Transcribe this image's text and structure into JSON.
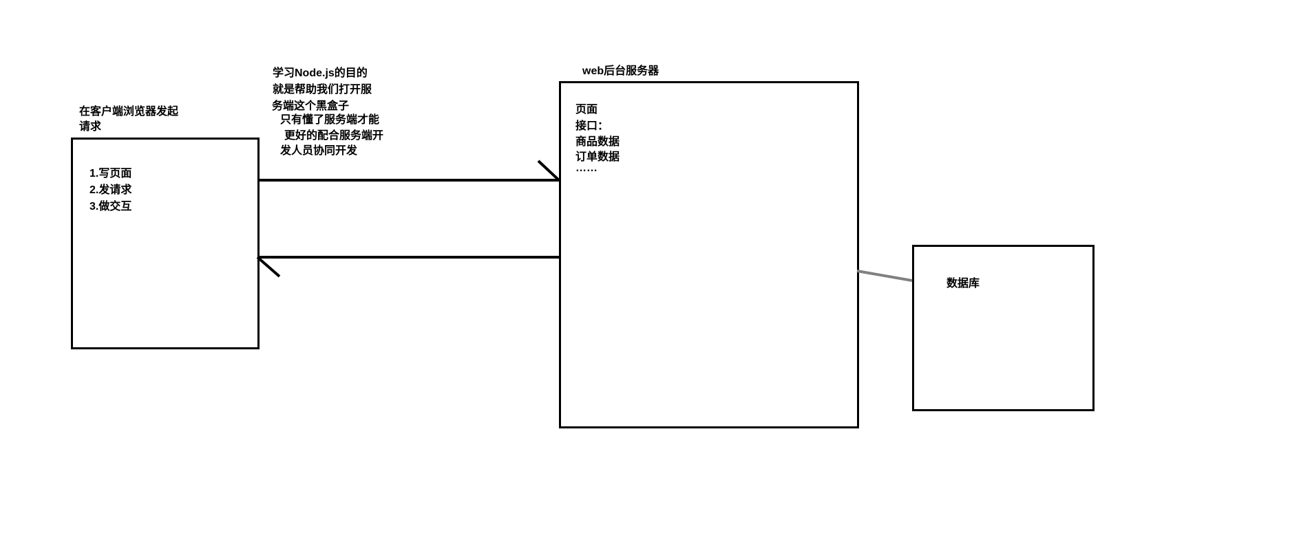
{
  "client": {
    "title_l1": "在客户端浏览器发起",
    "title_l2": "请求",
    "item1": "1.写页面",
    "item2": "2.发请求",
    "item3": "3.做交互"
  },
  "middle": {
    "l1": "学习Node.js的目的",
    "l2": "就是帮助我们打开服",
    "l3": "务端这个黑盒子",
    "l4": "只有懂了服务端才能",
    "l5": "更好的配合服务端开",
    "l6": "发人员协同开发"
  },
  "server": {
    "title": "web后台服务器",
    "item1": "页面",
    "item2": "接口：",
    "item3": "商品数据",
    "item4": "订单数据",
    "item5": "……"
  },
  "database": {
    "title": "数据库"
  }
}
